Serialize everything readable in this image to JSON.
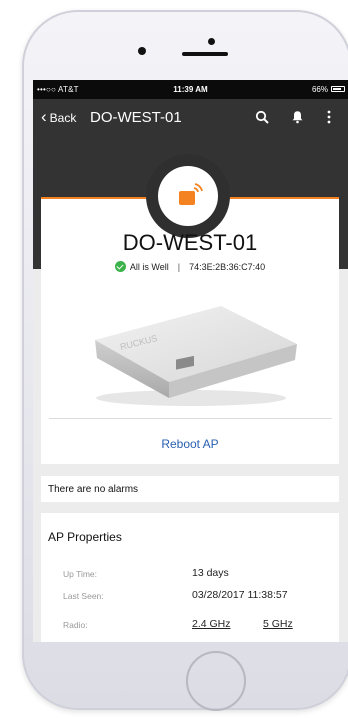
{
  "status_bar": {
    "carrier": "•••○○ AT&T",
    "time": "11:39 AM",
    "battery": "66%"
  },
  "app_bar": {
    "back_label": "Back",
    "title": "DO-WEST-01",
    "icons": [
      "search-icon",
      "bell-icon",
      "more-vert-icon"
    ]
  },
  "device": {
    "name": "DO-WEST-01",
    "status": "All is Well",
    "separator": "|",
    "mac": "74:3E:2B:36:C7:40",
    "reboot_label": "Reboot AP"
  },
  "alarms": {
    "message": "There are no alarms"
  },
  "ap_properties": {
    "title": "AP Properties",
    "rows": [
      {
        "label": "Up Time:",
        "value": "13 days"
      },
      {
        "label": "Last Seen:",
        "value": "03/28/2017 11:38:57"
      },
      {
        "label": "Radio:",
        "value": "2.4 GHz",
        "value2": "5 GHz"
      }
    ]
  },
  "colors": {
    "accent_orange": "#f58220",
    "appbar_dark": "#333333",
    "status_green": "#3bb34a",
    "link_blue": "#2a5fb0"
  }
}
